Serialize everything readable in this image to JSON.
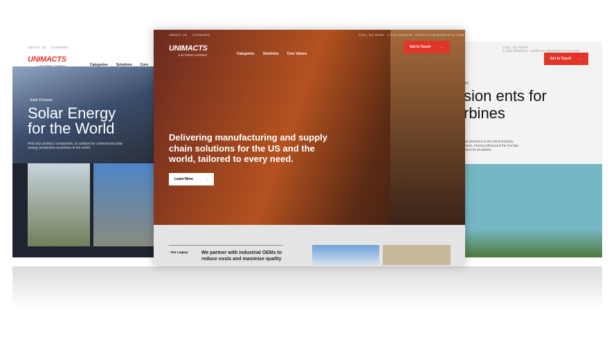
{
  "brand": {
    "logo": "UNIMACTS",
    "tagline": "A ZETWERK COMPANY",
    "accent": "#e2352a"
  },
  "topbar": {
    "about": "ABOUT US",
    "careers": "CAREERS",
    "phone": "CALL US NOW : 1.416.4156070",
    "email": "CONTACT@UNIMACTS.COM"
  },
  "nav": {
    "categories": "Categories",
    "solutions": "Solutions",
    "core_values": "Core Values",
    "cta": "Get In Touch",
    "arrow": "→"
  },
  "left": {
    "eyebrow": "Solar Products",
    "title": "Solar Energy for the World",
    "desc": "Find any product, component, or solution for commercial solar energy production anywhere in the world.",
    "nav_cut": "Core Va"
  },
  "center": {
    "headline": "Delivering manufacturing and supply chain solutions for the US and the world, tailored to every need.",
    "learn_more": "Learn More",
    "legacy_label": "Our Legacy",
    "legacy_text": "We partner with industrial OEMs to reduce costs and maximize quality"
  },
  "right": {
    "eyebrow": "RY",
    "title": "sion ents for rbines",
    "desc": "est pioneers in the wind industry. years, having witnessed the Europe since its inception."
  }
}
